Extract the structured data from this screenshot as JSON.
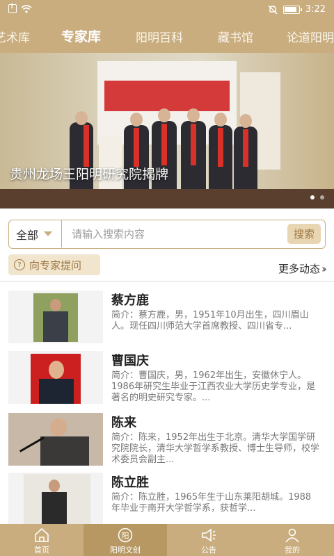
{
  "status_bar": {
    "time": "3:22"
  },
  "top_tabs": [
    {
      "label": "艺术库"
    },
    {
      "label": "专家库"
    },
    {
      "label": "阳明百科"
    },
    {
      "label": "藏书馆"
    },
    {
      "label": "论道阳明"
    }
  ],
  "banner": {
    "caption": "贵州龙场王阳明研究院揭牌"
  },
  "search": {
    "scope": "全部",
    "placeholder": "请输入搜索内容",
    "button": "搜索"
  },
  "ask_button": "向专家提问",
  "more_link": "更多动态",
  "experts": [
    {
      "name": "蔡方鹿",
      "desc": "简介：蔡方鹿，男，1951年10月出生，四川眉山人。现任四川师范大学首席教授、四川省专..."
    },
    {
      "name": "曹国庆",
      "desc": "简介：曹国庆，男，1962年出生，安徽休宁人。1986年研究生毕业于江西农业大学历史学专业，是著名的明史研究专家。..."
    },
    {
      "name": "陈来",
      "desc": "简介：陈来，1952年出生于北京。清华大学国学研究院院长，清华大学哲学系教授、博士生导师，校学术委员会副主..."
    },
    {
      "name": "陈立胜",
      "desc": "简介：陈立胜，1965年生于山东莱阳胡城。1988年毕业于南开大学哲学系，获哲学..."
    }
  ],
  "bottom_nav": [
    {
      "label": "首页",
      "icon": "home-icon"
    },
    {
      "label": "阳明文创",
      "icon": "circle-yang-icon"
    },
    {
      "label": "公告",
      "icon": "megaphone-icon"
    },
    {
      "label": "我的",
      "icon": "user-icon"
    }
  ],
  "colors": {
    "accent": "#c9ad7f",
    "accent_dark": "#9a7440",
    "active_tab": "#b79863"
  }
}
